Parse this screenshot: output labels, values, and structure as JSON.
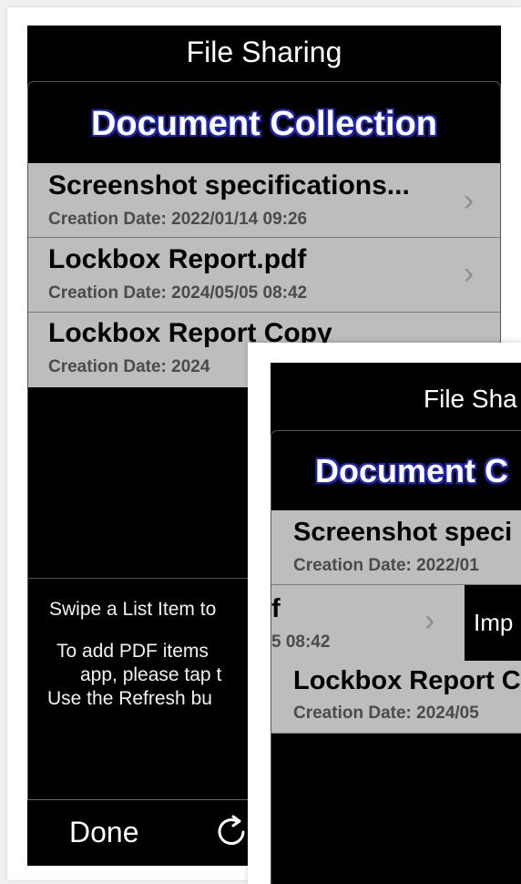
{
  "back": {
    "topbar_title": "File Sharing",
    "collection_title": "Document Collection",
    "items": [
      {
        "title": "Screenshot specifications...",
        "date": "Creation Date: 2022/01/14 09:26"
      },
      {
        "title": "Lockbox Report.pdf",
        "date": "Creation Date: 2024/05/05 08:42"
      },
      {
        "title": "Lockbox Report Copy",
        "date": "Creation Date: 2024"
      }
    ],
    "instructions": {
      "line1": "Swipe a List Item to",
      "line2": "To add PDF items",
      "line3": "app, please tap t",
      "line4": "Use the Refresh bu"
    },
    "done_label": "Done",
    "refresh_icon": "refresh-icon"
  },
  "front": {
    "topbar_title": "File Sha",
    "collection_title": "Document C",
    "items": [
      {
        "title": "Screenshot speci",
        "date": "Creation Date: 2022/01"
      },
      {
        "title": "f",
        "date": "5 08:42",
        "action": "Imp"
      },
      {
        "title": "Lockbox Report C",
        "date": "Creation Date: 2024/05"
      }
    ]
  },
  "colors": {
    "screen_bg": "#000000",
    "row_bg": "#bdbdbd",
    "title_outline": "#1f25b0",
    "text_white": "#ffffff"
  }
}
